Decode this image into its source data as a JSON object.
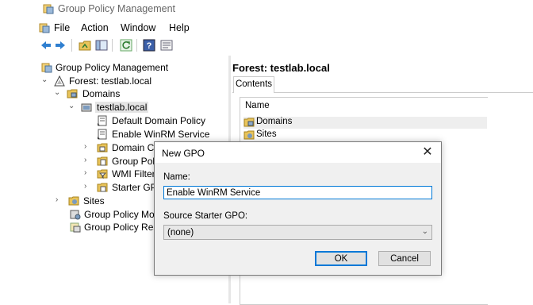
{
  "app": {
    "title": "Group Policy Management",
    "menu": [
      "File",
      "Action",
      "Window",
      "Help"
    ]
  },
  "tree": {
    "root": "Group Policy Management",
    "forest": "Forest: testlab.local",
    "domains": "Domains",
    "domain": "testlab.local",
    "items": [
      "Default Domain Policy",
      "Enable WinRM Service",
      "Domain Co",
      "Group Poli",
      "WMI Filters",
      "Starter GPO"
    ],
    "sites": "Sites",
    "modeling": "Group Policy Mod",
    "results": "Group Policy Resu"
  },
  "right_pane": {
    "title": "Forest: testlab.local",
    "tab": "Contents",
    "column": "Name",
    "rows": [
      "Domains",
      "Sites"
    ]
  },
  "dialog": {
    "title": "New GPO",
    "name_label": "Name:",
    "name_value": "Enable WinRM Service",
    "starter_label": "Source Starter GPO:",
    "starter_value": "(none)",
    "ok": "OK",
    "cancel": "Cancel",
    "close_glyph": "✕"
  }
}
